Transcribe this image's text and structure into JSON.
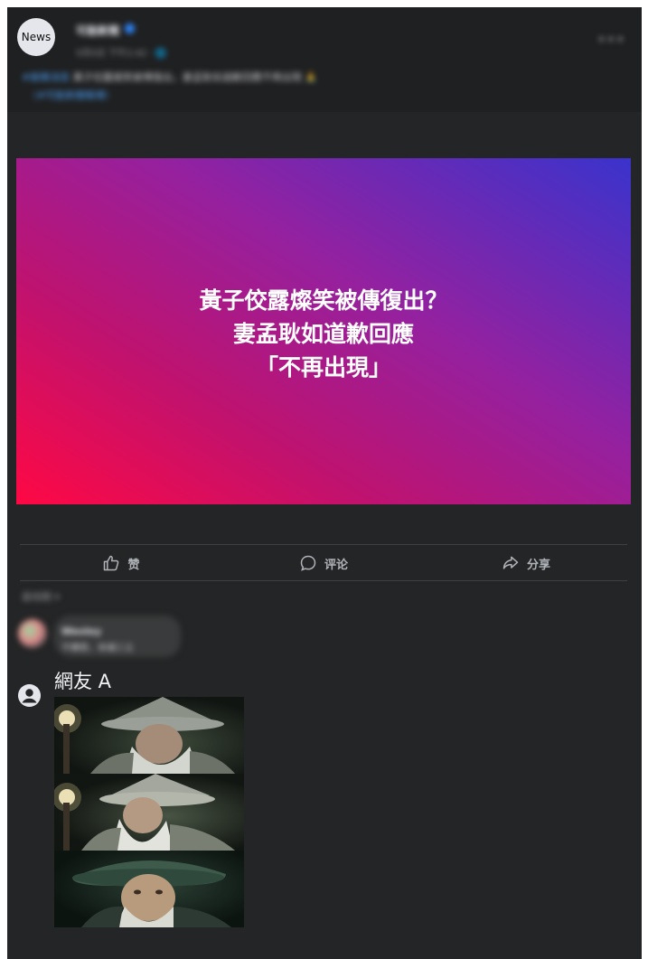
{
  "post": {
    "page_avatar_text": "News",
    "page_name": "可能新聞",
    "post_time": "5月5日 下午2:42 · 🌐",
    "caption_tag": "#娛樂消息",
    "caption_text": "黃子佼露燦笑被傳復出，妻孟耿如道歉回應不再出現 🙏",
    "caption_link": "（#可能新聞報導）",
    "more_icon": "more-horizontal-icon"
  },
  "hero": {
    "lines": [
      "黃子佼露燦笑被傳復出？",
      "妻孟耿如道歉回應",
      "「不再出現」"
    ],
    "gradient_colors": [
      "#ff0844",
      "#c0126e",
      "#9421a0",
      "#3a33cc"
    ]
  },
  "actions": [
    {
      "label": "赞",
      "icon": "thumbs-up-icon"
    },
    {
      "label": "评论",
      "icon": "comment-icon"
    },
    {
      "label": "分享",
      "icon": "share-icon"
    }
  ],
  "comments": {
    "sort_label": "最相關 ▾",
    "first": {
      "name": "Wesley",
      "text": "不轉發，來補三立"
    },
    "second": {
      "name": "網友 A",
      "icon": "user-circle-icon"
    }
  },
  "colors": {
    "background": "#242526",
    "text": "#e4e6eb",
    "muted": "#b0b3b8",
    "accent": "#2d88ff"
  }
}
